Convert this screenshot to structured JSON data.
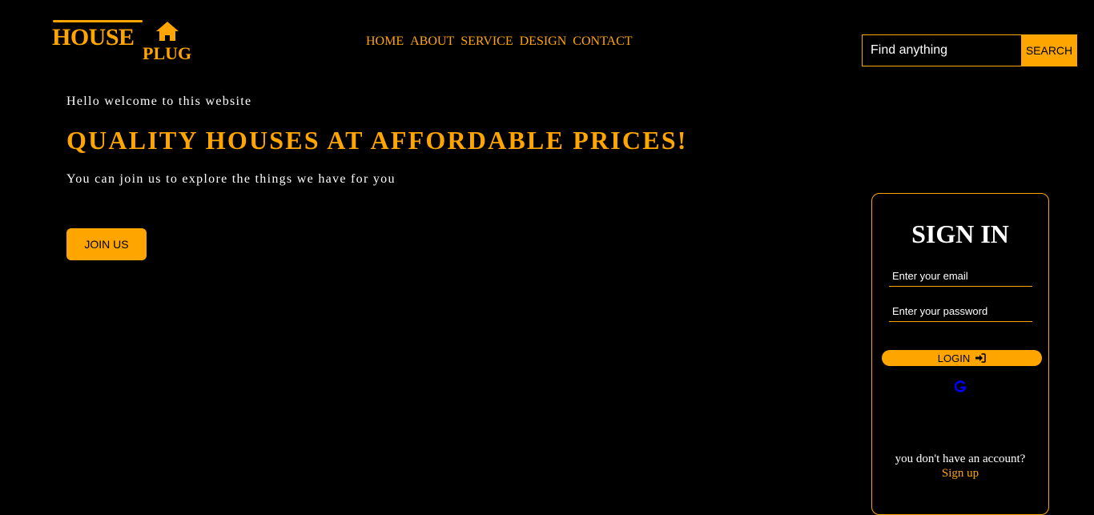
{
  "brand": {
    "name_top": "HOUSE",
    "name_bottom": "PLUG",
    "icon": "home-icon",
    "accent_color": "#FFA500",
    "background_color": "#000000"
  },
  "nav": {
    "items": [
      "HOME",
      "ABOUT",
      "SERVICE",
      "DESIGN",
      "CONTACT"
    ]
  },
  "search": {
    "placeholder": "Find anything",
    "button_label": "SEARCH"
  },
  "hero": {
    "greeting": "Hello welcome to this website",
    "title": "QUALITY HOUSES AT AFFORDABLE PRICES!",
    "subtext": "You can join us to explore the things we have for you",
    "join_label": "JOIN US"
  },
  "signin": {
    "title": "SIGN IN",
    "email_placeholder": "Enter your email",
    "password_placeholder": "Enter your password",
    "login_label": "LOGIN",
    "login_icon": "sign-in-icon",
    "google_icon": "google-icon",
    "no_account_text": "you don't have an account?",
    "signup_label": "Sign up"
  }
}
